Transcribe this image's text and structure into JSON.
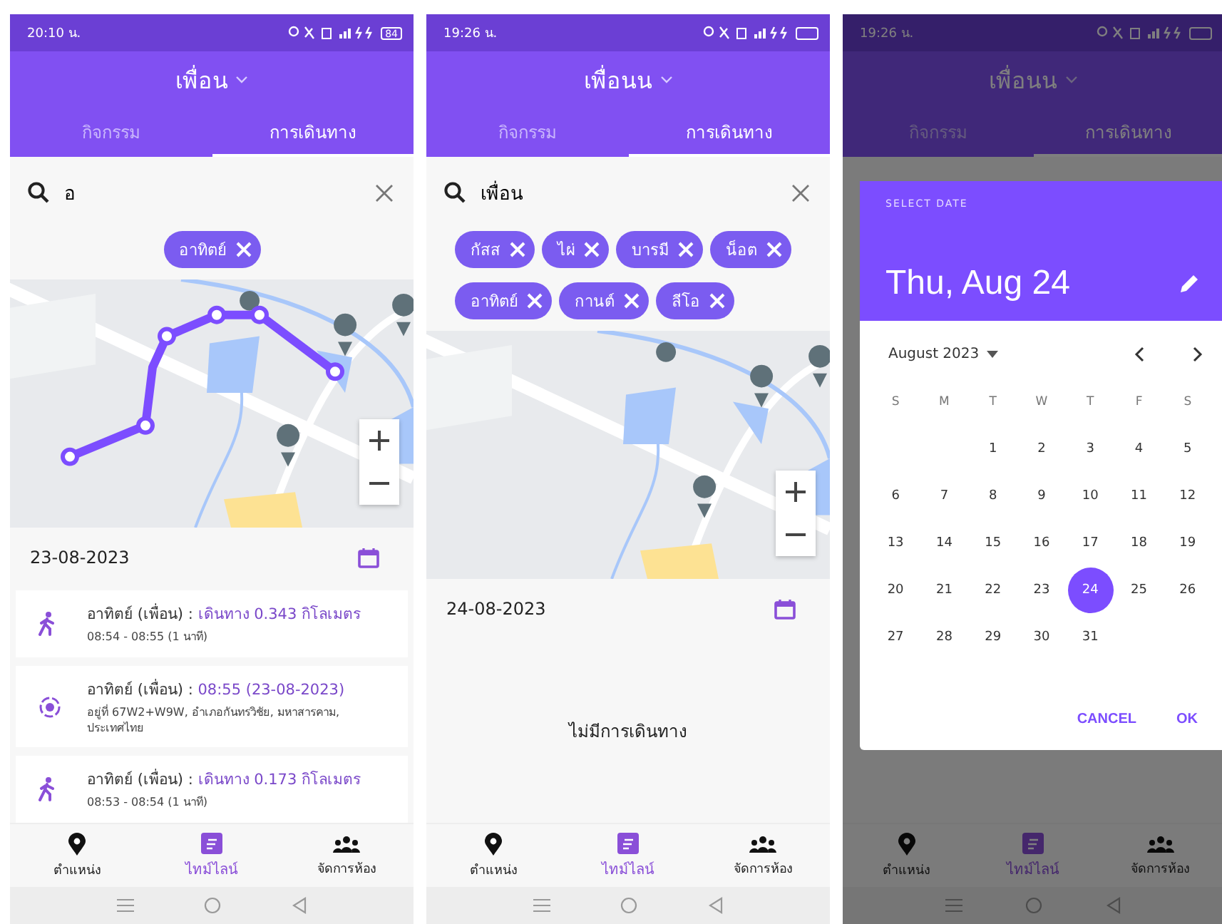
{
  "phones": [
    {
      "status_bar": {
        "time": "20:10 น.",
        "battery": "84"
      },
      "header": {
        "title": "เพื่อน",
        "tabs": [
          {
            "label": "กิจกรรม",
            "selected": false
          },
          {
            "label": "การเดินทาง",
            "selected": true
          }
        ]
      },
      "search": {
        "value": "อ"
      },
      "chips": [
        "อาทิตย์"
      ],
      "map": {
        "route": true
      },
      "date": "23-08-2023",
      "entries": [
        {
          "kind": "walk",
          "name": "อาทิตย์ (เพื่อน) :",
          "detail": "เดินทาง 0.343 กิโลเมตร",
          "sub": "08:54 - 08:55 (1 นาที)"
        },
        {
          "kind": "place",
          "name": "อาทิตย์ (เพื่อน) :",
          "detail": "08:55 (23-08-2023)",
          "sub": "อยู่ที่ 67W2+W9W, อำเภอกันทรวิชัย, มหาสารคาม, ประเทศไทย"
        },
        {
          "kind": "walk",
          "name": "อาทิตย์ (เพื่อน) :",
          "detail": "เดินทาง 0.173 กิโลเมตร",
          "sub": "08:53 - 08:54 (1 นาที)"
        }
      ],
      "bottom_nav": [
        {
          "label": "ตำแหน่ง",
          "selected": false
        },
        {
          "label": "ไทม์ไลน์",
          "selected": true
        },
        {
          "label": "จัดการห้อง",
          "selected": false
        }
      ]
    },
    {
      "status_bar": {
        "time": "19:26 น."
      },
      "header": {
        "title": "เพื่อนน",
        "tabs": [
          {
            "label": "กิจกรรม",
            "selected": false
          },
          {
            "label": "การเดินทาง",
            "selected": true
          }
        ]
      },
      "search": {
        "value": "เพื่อน"
      },
      "chips": [
        "กัสส",
        "ไผ่",
        "บารมี",
        "น็อต",
        "อาทิตย์",
        "กานต์",
        "ลีโอ"
      ],
      "map": {
        "route": false
      },
      "date": "24-08-2023",
      "empty_message": "ไม่มีการเดินทาง",
      "bottom_nav": [
        {
          "label": "ตำแหน่ง",
          "selected": false
        },
        {
          "label": "ไทม์ไลน์",
          "selected": true
        },
        {
          "label": "จัดการห้อง",
          "selected": false
        }
      ]
    },
    {
      "status_bar": {
        "time": "19:26 น."
      },
      "header": {
        "title": "เพื่อนน",
        "tabs": [
          {
            "label": "กิจกรรม",
            "selected": false
          },
          {
            "label": "การเดินทาง",
            "selected": true
          }
        ]
      },
      "bottom_nav": [
        {
          "label": "ตำแหน่ง",
          "selected": false
        },
        {
          "label": "ไทม์ไลน์",
          "selected": true
        },
        {
          "label": "จัดการห้อง",
          "selected": false
        }
      ],
      "dialog": {
        "caption": "SELECT DATE",
        "date": "Thu, Aug 24",
        "month": "August 2023",
        "weekdays": [
          "S",
          "M",
          "T",
          "W",
          "T",
          "F",
          "S"
        ],
        "weeks": [
          [
            {
              "label": "1",
              "selected": false
            },
            {
              "label": "2",
              "selected": false
            },
            {
              "label": "3",
              "selected": false
            },
            {
              "label": "4",
              "selected": false
            },
            {
              "label": "5",
              "selected": false
            }
          ],
          [
            {
              "label": "6",
              "selected": false
            },
            {
              "label": "7",
              "selected": false
            },
            {
              "label": "8",
              "selected": false
            },
            {
              "label": "9",
              "selected": false
            },
            {
              "label": "10",
              "selected": false
            },
            {
              "label": "11",
              "selected": false
            },
            {
              "label": "12",
              "selected": false
            }
          ],
          [
            {
              "label": "13",
              "selected": false
            },
            {
              "label": "14",
              "selected": false
            },
            {
              "label": "15",
              "selected": false
            },
            {
              "label": "16",
              "selected": false
            },
            {
              "label": "17",
              "selected": false
            },
            {
              "label": "18",
              "selected": false
            },
            {
              "label": "19",
              "selected": false
            }
          ],
          [
            {
              "label": "20",
              "selected": false
            },
            {
              "label": "21",
              "selected": false
            },
            {
              "label": "22",
              "selected": false
            },
            {
              "label": "23",
              "selected": false
            },
            {
              "label": "24",
              "selected": true
            },
            {
              "label": "25",
              "selected": false
            },
            {
              "label": "26",
              "selected": false
            }
          ],
          [
            {
              "label": "27",
              "selected": false
            },
            {
              "label": "28",
              "selected": false
            },
            {
              "label": "29",
              "selected": false
            },
            {
              "label": "30",
              "selected": false
            },
            {
              "label": "31",
              "selected": false
            }
          ]
        ],
        "buttons": [
          "CANCEL",
          "OK"
        ]
      }
    }
  ]
}
